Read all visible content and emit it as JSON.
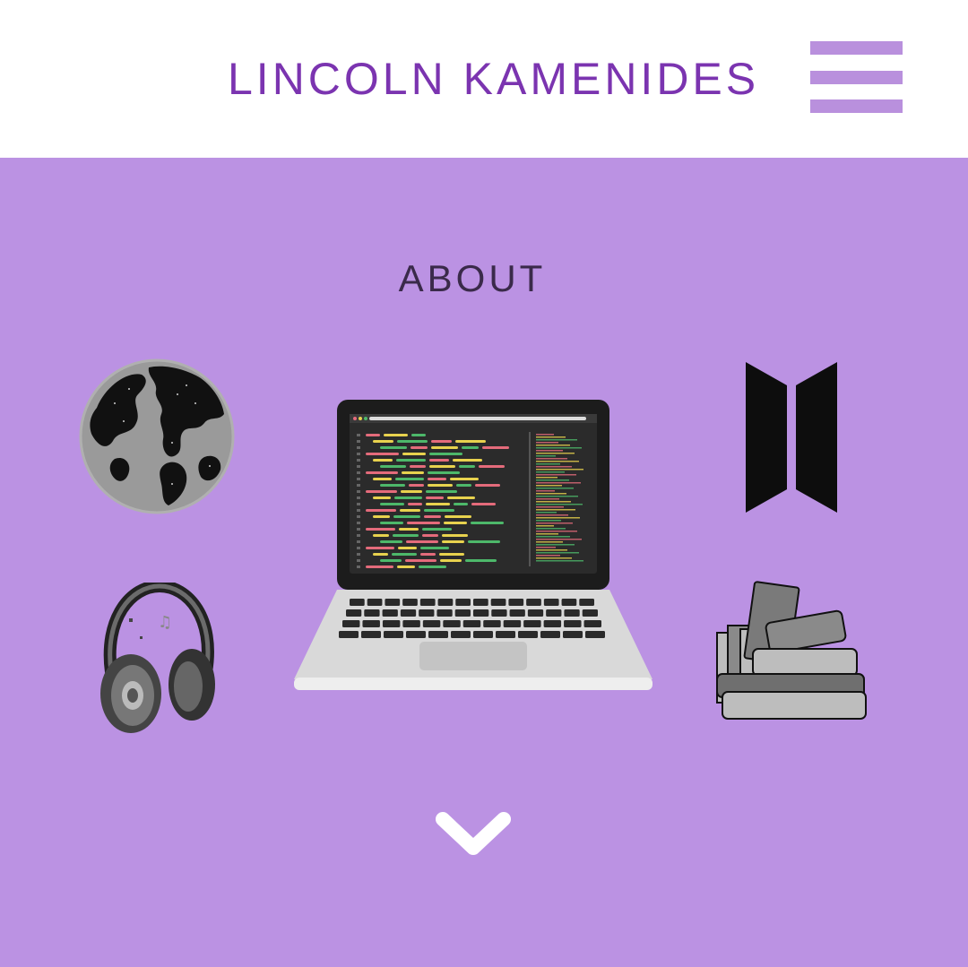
{
  "header": {
    "site_title": "LINCOLN KAMENIDES"
  },
  "icons": {
    "menu": "hamburger-menu-icon",
    "globe": "globe-icon",
    "headphones": "headphones-icon",
    "laptop": "laptop-code-icon",
    "bts_logo": "bts-logo-icon",
    "books": "books-icon",
    "scroll_down": "chevron-down-icon"
  },
  "about": {
    "title": "ABOUT"
  },
  "colors": {
    "accent": "#7b34b0",
    "menu_bars": "#b990dd",
    "section_bg": "#bb92e3",
    "section_title": "#3a2a4a",
    "header_bg": "#ffffff"
  }
}
